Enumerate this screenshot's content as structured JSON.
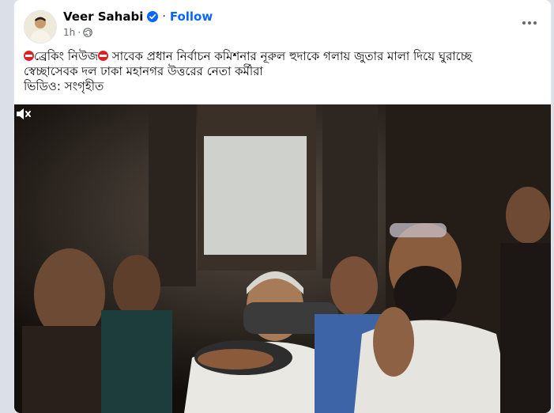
{
  "post": {
    "author": "Veer Sahabi",
    "follow_label": "Follow",
    "time": "1h",
    "separator": "·",
    "text_prefix": "ব্রেকিং নিউজ",
    "text_line1": " সাবেক প্রধান নির্বাচন কমিশনার নূরুল হুদাকে গলায় জুতার মালা দিয়ে ঘুরাচ্ছে",
    "text_line2": "স্বেচ্ছাসেবক দল ঢাকা মহানগর উত্তরের নেতা কর্মীরা",
    "text_line3": "ভিডিও: সংগৃহীত"
  },
  "icons": {
    "verified": "verified-badge-icon",
    "audience": "globe-icon",
    "more": "more-options-icon",
    "alert": "no-entry-emoji-icon",
    "volume": "volume-muted-icon"
  },
  "colors": {
    "brand_blue": "#0866ff",
    "text_primary": "#050505",
    "text_secondary": "#65676b",
    "alert_red": "#e02020"
  }
}
